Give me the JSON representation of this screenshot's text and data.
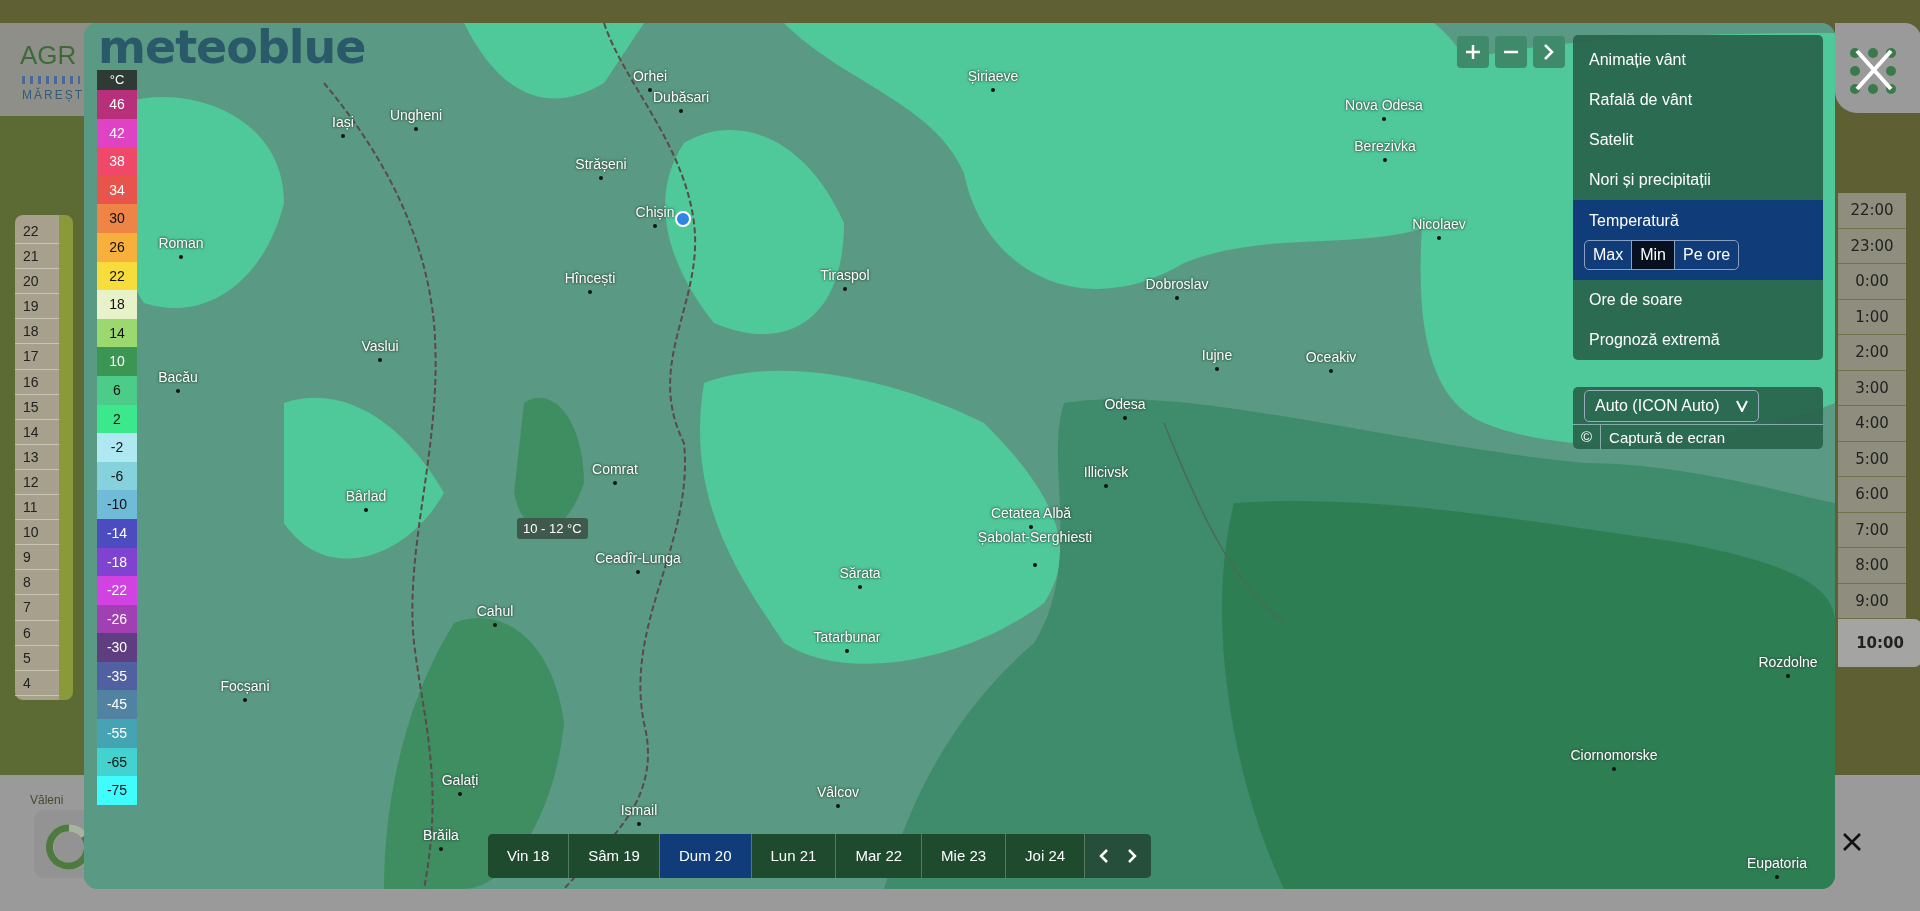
{
  "background": {
    "logo_text": "AGR",
    "logo_subtext": "MĂREȘT",
    "place": "Văleni",
    "scale": [
      "22",
      "21",
      "20",
      "19",
      "18",
      "17",
      "16",
      "15",
      "14",
      "13",
      "12",
      "11",
      "10",
      "9",
      "8",
      "7",
      "6",
      "5",
      "4"
    ]
  },
  "hours": [
    {
      "label": "22:00",
      "selected": false
    },
    {
      "label": "23:00",
      "selected": false
    },
    {
      "label": "0:00",
      "selected": false
    },
    {
      "label": "1:00",
      "selected": false
    },
    {
      "label": "2:00",
      "selected": false
    },
    {
      "label": "3:00",
      "selected": false
    },
    {
      "label": "4:00",
      "selected": false
    },
    {
      "label": "5:00",
      "selected": false
    },
    {
      "label": "6:00",
      "selected": false
    },
    {
      "label": "7:00",
      "selected": false
    },
    {
      "label": "8:00",
      "selected": false
    },
    {
      "label": "9:00",
      "selected": false
    },
    {
      "label": "10:00",
      "selected": true
    }
  ],
  "map": {
    "brand": "meteoblue",
    "tooltip": "10 - 12 °C",
    "legend": [
      {
        "label": "°C",
        "color": "#2e3a34"
      },
      {
        "label": "46",
        "color": "#b8307a"
      },
      {
        "label": "42",
        "color": "#e042c4"
      },
      {
        "label": "38",
        "color": "#f04868"
      },
      {
        "label": "34",
        "color": "#e8544c"
      },
      {
        "label": "30",
        "color": "#ee8446"
      },
      {
        "label": "26",
        "color": "#f8b03c"
      },
      {
        "label": "22",
        "color": "#f8dc3c"
      },
      {
        "label": "18",
        "color": "#e8f2c8"
      },
      {
        "label": "14",
        "color": "#9cd870"
      },
      {
        "label": "10",
        "color": "#3a9652"
      },
      {
        "label": "6",
        "color": "#4ccc88"
      },
      {
        "label": "2",
        "color": "#3ce88c"
      },
      {
        "label": "-2",
        "color": "#b0e8f2"
      },
      {
        "label": "-6",
        "color": "#86d2dc"
      },
      {
        "label": "-10",
        "color": "#70bcd8"
      },
      {
        "label": "-14",
        "color": "#4c4cc0"
      },
      {
        "label": "-18",
        "color": "#8042d0"
      },
      {
        "label": "-22",
        "color": "#d242e2"
      },
      {
        "label": "-26",
        "color": "#a040b2"
      },
      {
        "label": "-30",
        "color": "#5e3e80"
      },
      {
        "label": "-35",
        "color": "#5060a0"
      },
      {
        "label": "-45",
        "color": "#5282a2"
      },
      {
        "label": "-55",
        "color": "#44a4b4"
      },
      {
        "label": "-65",
        "color": "#44d2d0"
      },
      {
        "label": "-75",
        "color": "#40fcfc"
      }
    ],
    "places": [
      "Orhei",
      "Dubăsari",
      "Șiriaeve",
      "Nova Odesa",
      "Iași",
      "Ungheni",
      "Strășeni",
      "Berezivka",
      "Chișin",
      "Roman",
      "Nicolaev",
      "Hîncești",
      "Tiraspol",
      "Dobroslav",
      "Vaslui",
      "Iujne",
      "Oceakiv",
      "Bacău",
      "Odesa",
      "Comrat",
      "Illicivsk",
      "Bârlad",
      "Cetatea Albă",
      "Șabolat-Serghiesti",
      "Ceadîr-Lunga",
      "Sărata",
      "Cahul",
      "Tatarbunar",
      "Rozdolne",
      "Focșani",
      "Ciornomorske",
      "Galați",
      "Ismail",
      "Vâlcov",
      "Brăila",
      "Eupatoria"
    ]
  },
  "layers": [
    {
      "label": "Animație vânt",
      "selected": false
    },
    {
      "label": "Rafală de vânt",
      "selected": false
    },
    {
      "label": "Satelit",
      "selected": false
    },
    {
      "label": "Nori și precipitații",
      "selected": false
    },
    {
      "label": "Temperatură",
      "selected": true,
      "options": [
        {
          "label": "Max",
          "selected": false
        },
        {
          "label": "Min",
          "selected": true
        },
        {
          "label": "Pe ore",
          "selected": false
        }
      ]
    },
    {
      "label": "Ore de soare",
      "selected": false
    },
    {
      "label": "Prognoză extremă",
      "selected": false
    }
  ],
  "model": {
    "value": "Auto (ICON Auto)",
    "copyright": "©",
    "screenshot": "Captură de ecran"
  },
  "days": [
    {
      "label": "Vin 18",
      "selected": false
    },
    {
      "label": "Sâm 19",
      "selected": false
    },
    {
      "label": "Dum 20",
      "selected": true
    },
    {
      "label": "Lun 21",
      "selected": false
    },
    {
      "label": "Mar 22",
      "selected": false
    },
    {
      "label": "Mie 23",
      "selected": false
    },
    {
      "label": "Joi 24",
      "selected": false
    }
  ]
}
